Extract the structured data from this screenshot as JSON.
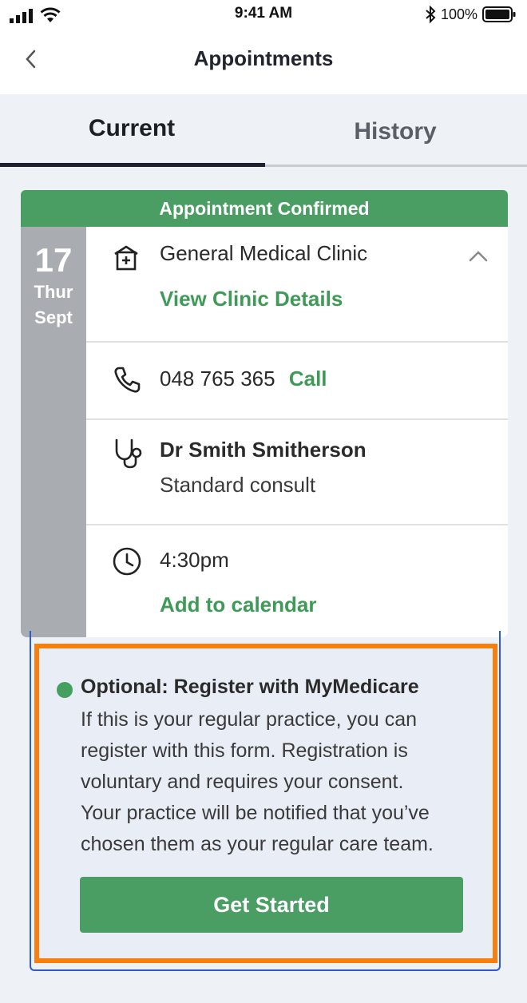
{
  "status_bar": {
    "time": "9:41 AM",
    "battery": "100%",
    "icons": [
      "signal-icon",
      "wifi-icon",
      "bluetooth-icon",
      "battery-icon"
    ]
  },
  "header": {
    "title": "Appointments",
    "back_icon": "chevron-left-icon"
  },
  "tabs": [
    {
      "label": "Current",
      "active": true
    },
    {
      "label": "History",
      "active": false
    }
  ],
  "appointment": {
    "status": "Appointment Confirmed",
    "date": {
      "day": "17",
      "weekday": "Thur",
      "month": "Sept"
    },
    "clinic": {
      "name": "General Medical Clinic",
      "link": "View Clinic Details",
      "icon": "hospital-icon",
      "collapse_icon": "chevron-up-icon"
    },
    "phone": {
      "number": "048 765 365",
      "action": "Call",
      "icon": "phone-icon"
    },
    "doctor": {
      "name": "Dr Smith Smitherson",
      "type": "Standard consult",
      "icon": "stethoscope-icon"
    },
    "time": {
      "value": "4:30pm",
      "action": "Add to calendar",
      "icon": "clock-icon"
    }
  },
  "register": {
    "title": "Optional: Register with MyMedicare",
    "body_lines": [
      "If this is your regular practice, you can",
      "register with this form. Registration is",
      "voluntary and requires your consent.",
      "Your practice will be notified that you’ve",
      "chosen them as your regular care team."
    ],
    "button": "Get Started"
  },
  "colors": {
    "accent_green": "#4a9e63",
    "link_green": "#3f9a57",
    "highlight_orange": "#f77f0d",
    "focus_blue": "#2a5bd7",
    "date_gray": "#a9acb1"
  }
}
